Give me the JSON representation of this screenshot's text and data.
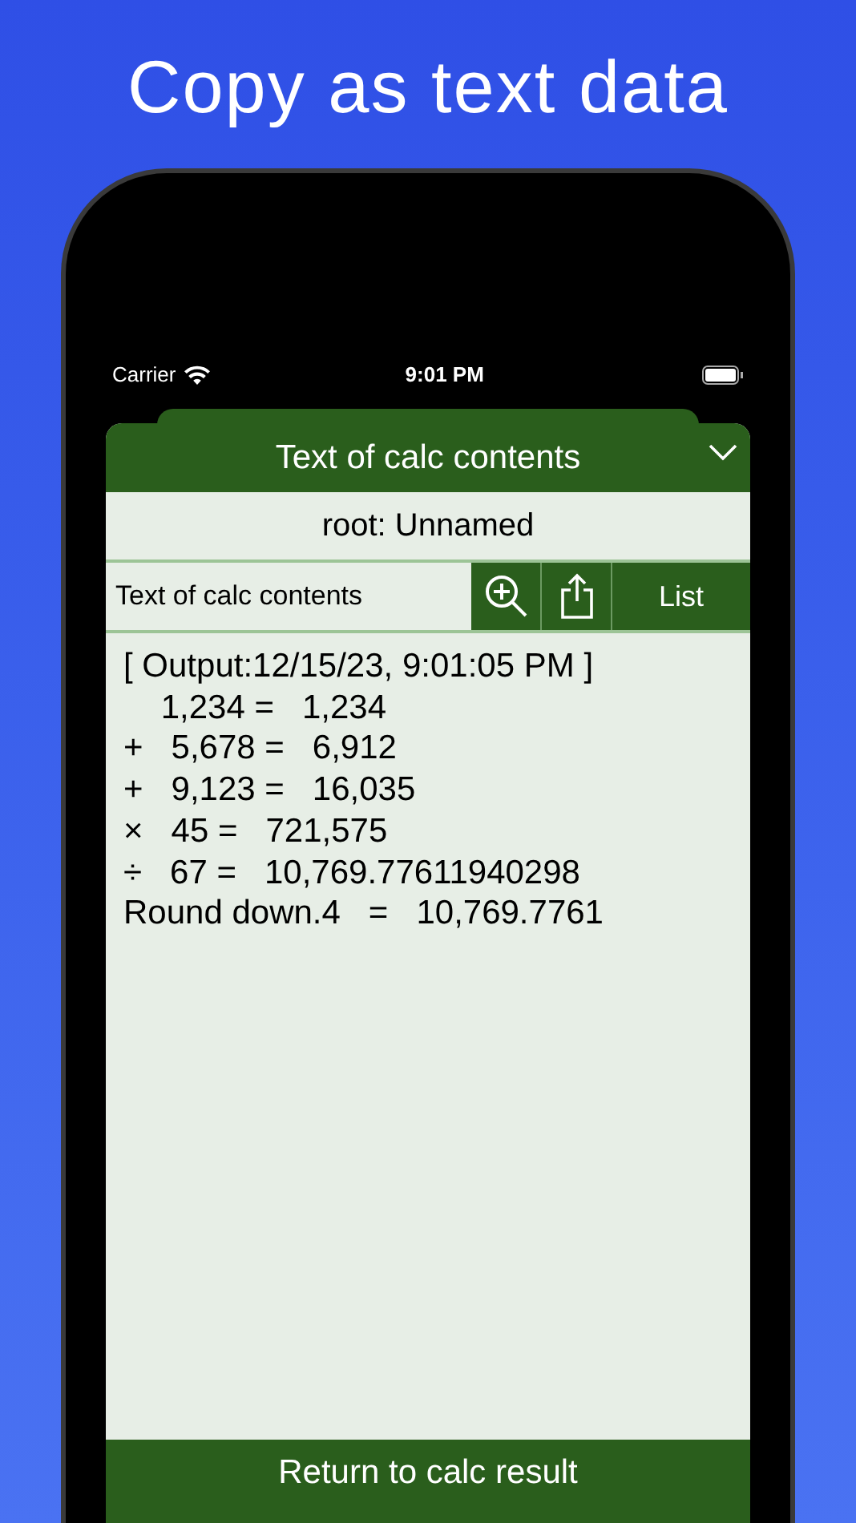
{
  "headline": "Copy as text data",
  "status_bar": {
    "carrier": "Carrier",
    "time": "9:01 PM"
  },
  "sheet": {
    "title": "Text of calc contents",
    "subtitle": "root: Unnamed",
    "toolbar": {
      "field_value": "Text of calc contents",
      "list_button": "List"
    },
    "lines": [
      "[ Output:12/15/23, 9:01:05 PM ]",
      "    1,234 =   1,234",
      "+   5,678 =   6,912",
      "+   9,123 =   16,035",
      "×   45 =   721,575",
      "÷   67 =   10,769.77611940298",
      "Round down.4   =   10,769.7761"
    ],
    "return_button": "Return to calc result"
  }
}
